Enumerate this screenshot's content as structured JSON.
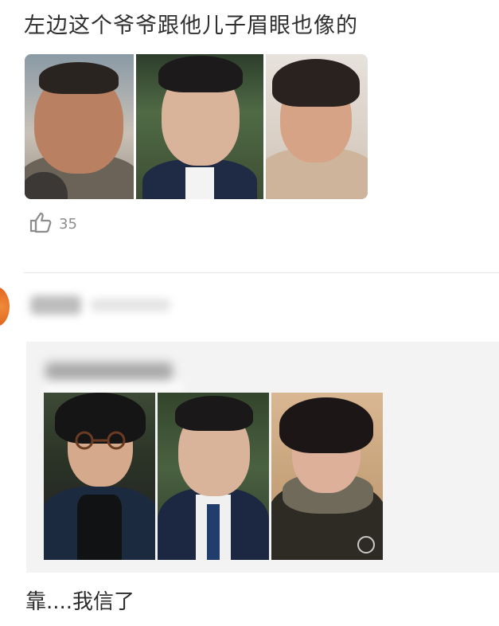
{
  "comment_1": {
    "text": "左边这个爷爷跟他儿子眉眼也像的",
    "photos": [
      "older-man-photo",
      "young-man-photo",
      "woman-photo"
    ],
    "like_icon": "thumbs-up-icon",
    "like_count": "35"
  },
  "comment_2": {
    "avatar_color": "#e46b25",
    "quote_photos": [
      "man-with-glasses-photo",
      "young-man-photo",
      "woman-photo"
    ],
    "text": "靠....我信了"
  }
}
